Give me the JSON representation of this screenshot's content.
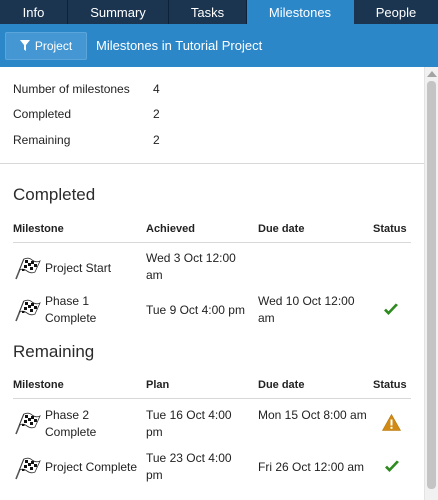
{
  "tabs": [
    {
      "label": "Info"
    },
    {
      "label": "Summary"
    },
    {
      "label": "Tasks"
    },
    {
      "label": "Milestones"
    },
    {
      "label": "People"
    }
  ],
  "active_tab": "Milestones",
  "toolbar": {
    "project_button_label": "Project",
    "title": "Milestones in Tutorial Project"
  },
  "stats": {
    "number_label": "Number of milestones",
    "number_value": "4",
    "completed_label": "Completed",
    "completed_value": "2",
    "remaining_label": "Remaining",
    "remaining_value": "2"
  },
  "completed": {
    "title": "Completed",
    "headers": {
      "milestone": "Milestone",
      "date1": "Achieved",
      "date2": "Due date",
      "status": "Status"
    },
    "rows": [
      {
        "name": "Project Start",
        "date1": "Wed 3 Oct 12:00 am",
        "date2": "",
        "status": "none"
      },
      {
        "name": "Phase 1 Complete",
        "date1": "Tue 9 Oct 4:00 pm",
        "date2": "Wed 10 Oct 12:00 am",
        "status": "check-icon"
      }
    ]
  },
  "remaining": {
    "title": "Remaining",
    "headers": {
      "milestone": "Milestone",
      "date1": "Plan",
      "date2": "Due date",
      "status": "Status"
    },
    "rows": [
      {
        "name": "Phase 2 Complete",
        "date1": "Tue 16 Oct 4:00 pm",
        "date2": "Mon 15 Oct 8:00 am",
        "status": "warning-icon"
      },
      {
        "name": "Project Complete",
        "date1": "Tue 23 Oct 4:00 pm",
        "date2": "Fri 26 Oct 12:00 am",
        "status": "check-icon"
      }
    ]
  },
  "colors": {
    "tabbar_bg": "#1b3550",
    "accent": "#2c87c9",
    "check": "#2e8b1f",
    "warning": "#d18a13"
  }
}
